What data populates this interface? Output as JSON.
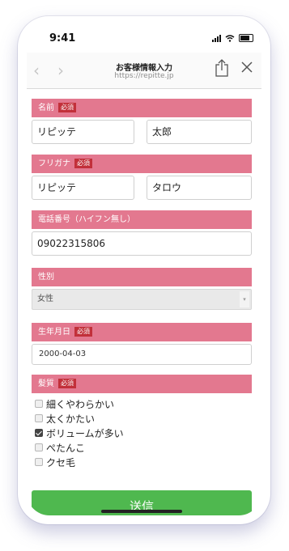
{
  "status_bar": {
    "time": "9:41"
  },
  "nav": {
    "back_icon": "chevron-left-icon",
    "forward_icon": "chevron-right-icon",
    "title": "お客様情報入力",
    "url": "https://repitte.jp",
    "share_icon": "share-icon",
    "close_icon": "close-icon"
  },
  "form": {
    "required_text": "必須",
    "name": {
      "label": "名前",
      "last_name": "リピッテ",
      "first_name": "太郎"
    },
    "furigana": {
      "label": "フリガナ",
      "last_name": "リピッテ",
      "first_name": "タロウ"
    },
    "phone": {
      "label": "電話番号（ハイフン無し）",
      "value": "09022315806"
    },
    "gender": {
      "label": "性別",
      "selected": "女性"
    },
    "birthday": {
      "label": "生年月日",
      "value": "2000-04-03"
    },
    "hair": {
      "label": "髪質",
      "options": [
        {
          "label": "細くやわらかい",
          "checked": false
        },
        {
          "label": "太くかたい",
          "checked": false
        },
        {
          "label": "ボリュームが多い",
          "checked": true
        },
        {
          "label": "ぺたんこ",
          "checked": false
        },
        {
          "label": "クセ毛",
          "checked": false
        }
      ]
    },
    "submit_label": "送信"
  },
  "colors": {
    "section_header": "#e3788f",
    "required_badge": "#c2303a",
    "submit": "#4fb84f"
  }
}
